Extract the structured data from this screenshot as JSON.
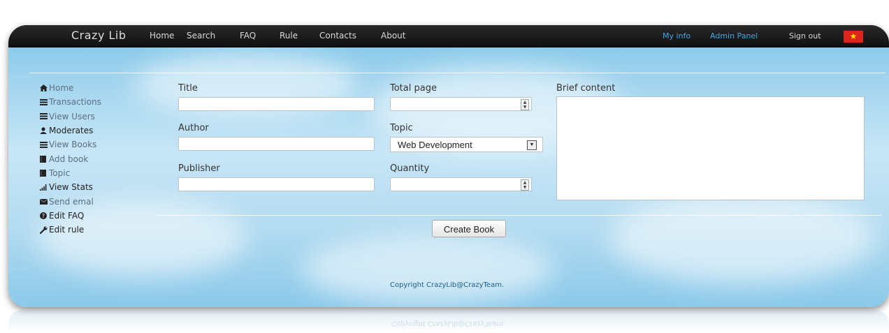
{
  "brand": "Crazy Lib",
  "nav": {
    "left": [
      "Home",
      "Search",
      "FAQ",
      "Rule",
      "Contacts",
      "About"
    ],
    "right": [
      "My info",
      "Admin Panel",
      "Sign out"
    ]
  },
  "colors": {
    "topbar": "#111111",
    "accent_link": "#3fa9e8",
    "flag": "#da251d"
  },
  "sidebar": {
    "items": [
      {
        "label": "Home",
        "icon": "home-icon"
      },
      {
        "label": "Transactions",
        "icon": "list-icon"
      },
      {
        "label": "View Users",
        "icon": "list-icon"
      },
      {
        "label": "Moderates",
        "icon": "user-icon"
      },
      {
        "label": "View Books",
        "icon": "list-icon"
      },
      {
        "label": "Add book",
        "icon": "book-icon"
      },
      {
        "label": "Topic",
        "icon": "book-icon"
      },
      {
        "label": "View Stats",
        "icon": "signal-icon"
      },
      {
        "label": "Send emal",
        "icon": "envelope-icon"
      },
      {
        "label": "Edit FAQ",
        "icon": "question-icon"
      },
      {
        "label": "Edit rule",
        "icon": "wrench-icon"
      }
    ]
  },
  "form": {
    "title_label": "Title",
    "title_value": "",
    "author_label": "Author",
    "author_value": "",
    "publisher_label": "Publisher",
    "publisher_value": "",
    "total_page_label": "Total page",
    "total_page_value": "",
    "topic_label": "Topic",
    "topic_selected": "Web Development",
    "quantity_label": "Quantity",
    "quantity_value": "",
    "brief_label": "Brief content",
    "brief_value": "",
    "submit_label": "Create Book"
  },
  "footer": {
    "copyright": "Copyright CrazyLib@CrazyTeam."
  }
}
